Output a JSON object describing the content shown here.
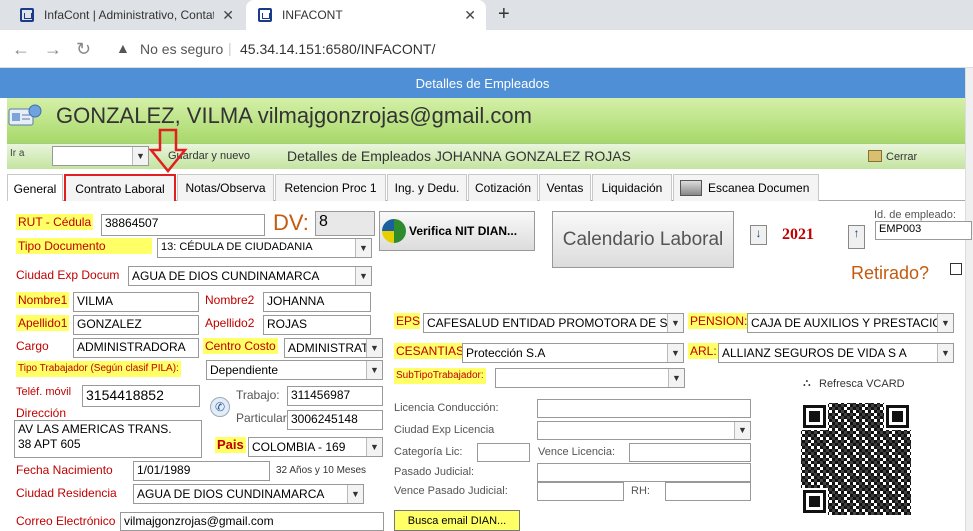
{
  "browser": {
    "tabs": [
      {
        "label": "InfaCont | Administrativo, Contat"
      },
      {
        "label": "INFACONT"
      }
    ],
    "new_tab": "+",
    "security": "No es seguro",
    "url": "45.34.14.151:6580/INFACONT/"
  },
  "window_title": "Detalles de Empleados",
  "employee_header": "GONZALEZ, VILMA vilmajgonzrojas@gmail.com",
  "toolbar": {
    "goto_label": "Ir a",
    "save_new_label": "Guardar y nuevo",
    "detail_title": "Detalles de Empleados JOHANNA GONZALEZ ROJAS",
    "close_label": "Cerrar"
  },
  "tabs": [
    "General",
    "Contrato Laboral",
    "Notas/Observa",
    "Retencion Proc 1",
    "Ing. y Dedu.",
    "Cotización",
    "Ventas",
    "Liquidación",
    "Escanea Documen"
  ],
  "form": {
    "rut_label": "RUT - Cédula",
    "rut_value": "38864507",
    "dv_label": "DV:",
    "dv_value": "8",
    "verify_button": "Verifica NIT DIAN...",
    "calendar_button": "Calendario Laboral",
    "year": "2021",
    "emp_id_label": "Id. de empleado:",
    "emp_id_value": "EMP003",
    "retired_label": "Retirado?",
    "tipo_doc_label": "Tipo Documento",
    "tipo_doc_value": "13: CÉDULA DE CIUDADANIA",
    "ciudad_exp_label": "Ciudad Exp Docum",
    "ciudad_exp_value": "AGUA DE DIOS  CUNDINAMARCA",
    "nombre1_label": "Nombre1",
    "nombre1_value": "VILMA",
    "nombre2_label": "Nombre2",
    "nombre2_value": "JOHANNA",
    "apellido1_label": "Apellido1",
    "apellido1_value": "GONZALEZ",
    "apellido2_label": "Apellido2",
    "apellido2_value": "ROJAS",
    "cargo_label": "Cargo",
    "cargo_value": "ADMINISTRADORA",
    "centro_costo_label": "Centro Costo",
    "centro_costo_value": "ADMINISTRAT",
    "tipo_trab_label": "Tipo Trabajador (Según clasif PILA):",
    "tipo_trab_value": "Dependiente",
    "telefono_label": "Teléf. móvil",
    "telefono_value": "3154418852",
    "trabajo_label": "Trabajo:",
    "trabajo_value": "311456987",
    "particular_label": "Particular:",
    "particular_value": "3006245148",
    "direccion_label": "Dirección",
    "direccion_line1": "AV LAS AMERICAS TRANS.",
    "direccion_line2": "38 APT 605",
    "pais_label": "Pais",
    "pais_value": "COLOMBIA - 169",
    "fecha_nac_label": "Fecha Nacimiento",
    "fecha_nac_value": "1/01/1989",
    "edad_text": "32 Años y 10 Meses",
    "ciudad_res_label": "Ciudad Residencia",
    "ciudad_res_value": "AGUA DE DIOS  CUNDINAMARCA",
    "correo_label": "Correo Electrónico",
    "correo_value": "vilmajgonzrojas@gmail.com",
    "eps_label": "EPS",
    "eps_value": "CAFESALUD ENTIDAD PROMOTORA DE S",
    "pension_label": "PENSION:",
    "pension_value": "CAJA DE AUXILIOS Y PRESTACIO",
    "cesantias_label": "CESANTIAS",
    "cesantias_value": "Protección S.A",
    "arl_label": "ARL:",
    "arl_value": "ALLIANZ SEGUROS DE VIDA S A",
    "subtipo_label": "SubTipoTrabajador:",
    "subtipo_value": "",
    "refresca_label": "Refresca VCARD",
    "licencia_label": "Licencia Conducción:",
    "ciudad_lic_label": "Ciudad Exp Licencia",
    "categoria_label": "Categoría Lic:",
    "vence_lic_label": "Vence Licencia:",
    "pasado_label": "Pasado Judicial:",
    "vence_pasado_label": "Vence Pasado Judicial:",
    "rh_label": "RH:",
    "busca_email_button": "Busca email DIAN..."
  },
  "colors": {
    "title_bar": "#4e8fd6",
    "header_green": "#a7d86a",
    "label_yellow": "#ffff66",
    "label_red": "#c00000",
    "year_red": "#c00000",
    "retired_orange": "#c55a11",
    "annotation_red": "#e02020"
  }
}
